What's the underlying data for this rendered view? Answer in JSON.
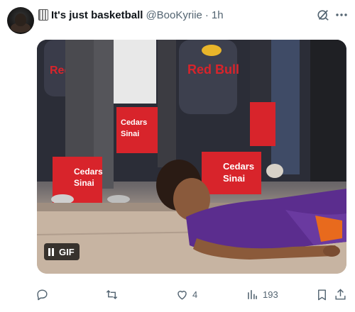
{
  "post": {
    "display_name": "It's just basketball",
    "handle": "@BooKyriie",
    "separator": "·",
    "time": "1h"
  },
  "media": {
    "gif_label": "GIF",
    "ads": {
      "red_bull": "Red Bull",
      "red_bull_partial": "Red",
      "cedars": "Cedars",
      "sinai": "Sinai"
    }
  },
  "actions": {
    "reply_count": "",
    "repost_count": "",
    "like_count": "4",
    "views_count": "193"
  },
  "icons": {
    "grok": "grok-icon",
    "more": "more-icon",
    "reply": "reply-icon",
    "repost": "repost-icon",
    "like": "heart-icon",
    "views": "views-icon",
    "bookmark": "bookmark-icon",
    "share": "share-icon",
    "pause": "pause-icon"
  },
  "colors": {
    "text_primary": "#0f1419",
    "text_secondary": "#536471",
    "court_banner_red": "#d8242b",
    "jersey_purple": "#5b2d8e",
    "jersey_orange": "#e86a1d"
  }
}
